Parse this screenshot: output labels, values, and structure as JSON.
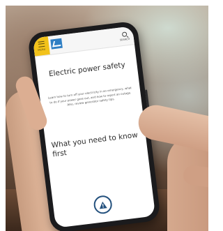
{
  "header": {
    "menu_label": "MENU",
    "search_label": "SEARCH",
    "menu_icon": "hamburger-icon",
    "search_icon": "search-icon",
    "logo_icon": "checkmark-logo",
    "accent_color": "#f2c21a",
    "logo_color": "#2f7fc4"
  },
  "page": {
    "title": "Electric power safety",
    "intro": "Learn how to turn off your electricity in an emergency, what to do if your power goes out, and how to report an outage. Also, review generator safety tips.",
    "section_heading": "What you need to know first"
  },
  "fab": {
    "icon": "warning-triangle-icon",
    "color": "#23507d"
  }
}
